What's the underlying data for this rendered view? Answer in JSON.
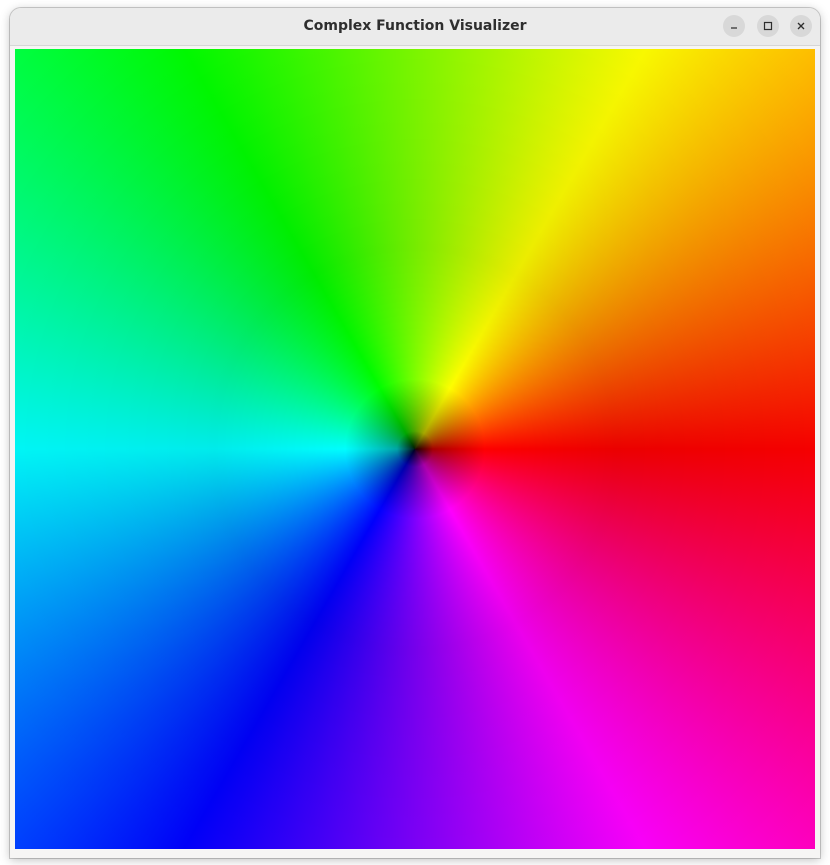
{
  "window": {
    "title": "Complex Function Visualizer"
  },
  "controls": {
    "minimize_icon": "minimize-icon",
    "maximize_icon": "maximize-icon",
    "close_icon": "close-icon"
  },
  "plot": {
    "color_scheme": [
      "#ff0000",
      "#ff00ff",
      "#0000ff",
      "#00ffff",
      "#00ff00",
      "#ffff00"
    ]
  }
}
